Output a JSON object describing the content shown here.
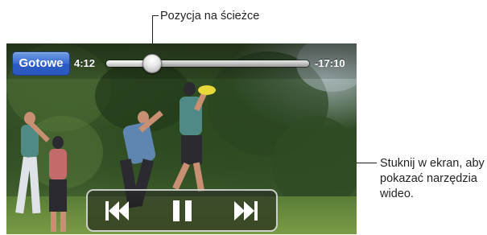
{
  "callouts": {
    "scrubber": "Pozycja na ścieżce",
    "tap_hint": "Stuknij w ekran, aby pokazać narzędzia wideo."
  },
  "player": {
    "done_label": "Gotowe",
    "elapsed": "4:12",
    "remaining": "-17:10",
    "progress_fraction": 0.2,
    "controls": [
      "previous-icon",
      "pause-icon",
      "next-icon"
    ]
  },
  "colors": {
    "done_button": "#3b6cd4",
    "annotation_text": "#231f20"
  }
}
